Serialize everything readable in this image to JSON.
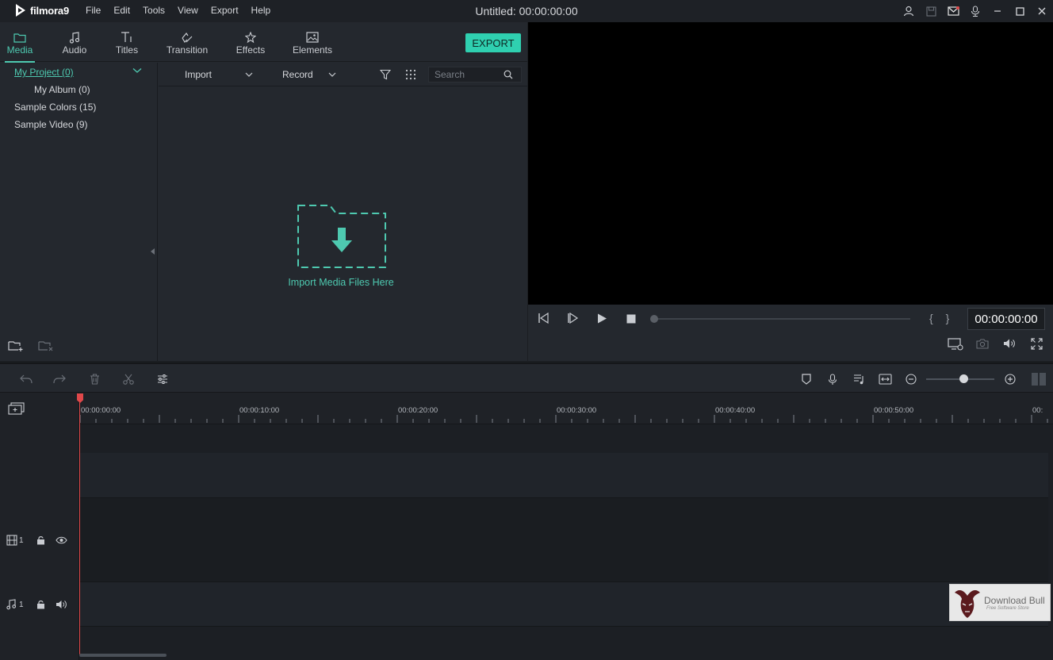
{
  "app": {
    "logo_text": "filmora9"
  },
  "menu": [
    "File",
    "Edit",
    "Tools",
    "View",
    "Export",
    "Help"
  ],
  "document": {
    "title": "Untitled:",
    "timecode": "00:00:00:00"
  },
  "media_tabs": [
    "Media",
    "Audio",
    "Titles",
    "Transition",
    "Effects",
    "Elements"
  ],
  "export_label": "EXPORT",
  "tree": {
    "items": [
      "My Project (0)",
      "My Album (0)",
      "Sample Colors (15)",
      "Sample Video (9)"
    ]
  },
  "library": {
    "import_label": "Import",
    "record_label": "Record",
    "search_placeholder": "Search",
    "drop_label": "Import Media Files Here"
  },
  "player": {
    "timecode": "00:00:00:00",
    "progress": 0
  },
  "timeline": {
    "ticks": [
      "00:00:00:00",
      "00:00:10:00",
      "00:00:20:00",
      "00:00:30:00",
      "00:00:40:00",
      "00:00:50:00",
      "00:"
    ],
    "video_track_label": "1",
    "audio_track_label": "1",
    "zoom_level": 0.55
  },
  "watermark": {
    "title": "Download Bull",
    "subtitle": "Free Software Store"
  },
  "colors": {
    "accent": "#4ec9b0",
    "export_button": "#2fd0b0",
    "playhead": "#e0484a"
  }
}
